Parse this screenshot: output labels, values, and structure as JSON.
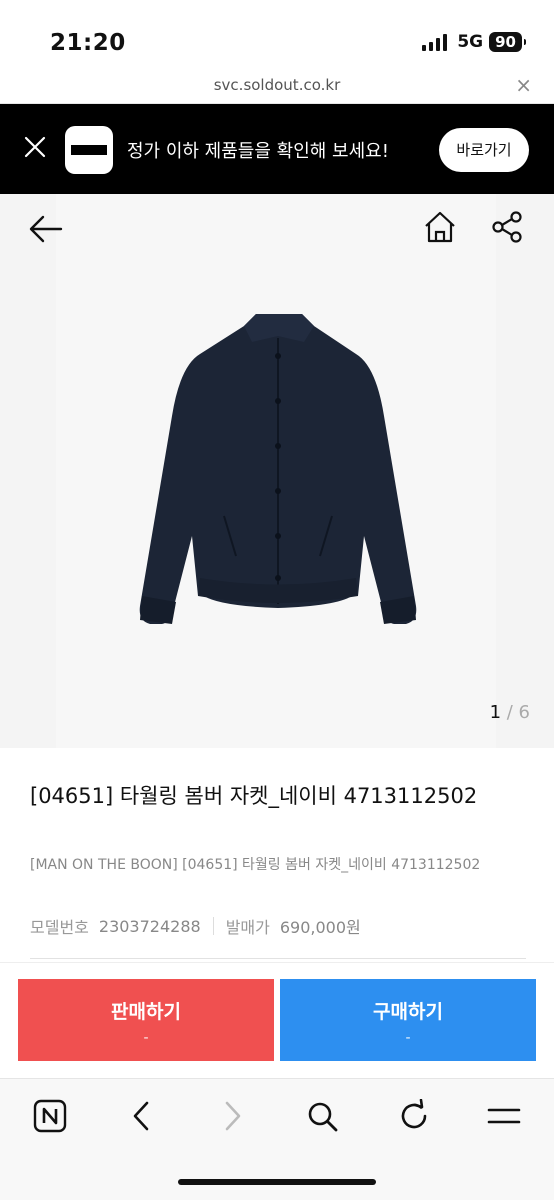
{
  "status": {
    "time": "21:20",
    "network": "5G",
    "battery": "90"
  },
  "browser": {
    "url": "svc.soldout.co.kr",
    "close_label": "×"
  },
  "promo": {
    "text": "정가 이하 제품들을 확인해 보세요!",
    "button_label": "바로가기"
  },
  "gallery": {
    "current": "1",
    "separator": " / ",
    "total": "6"
  },
  "product": {
    "title": "[04651] 타월링 봄버 자켓_네이비 4713112502",
    "subtitle": "[MAN ON THE BOON] [04651] 타월링 봄버 자켓_네이비 4713112502",
    "model_label": "모델번호",
    "model_value": "2303724288",
    "price_label": "발매가",
    "price_value": "690,000원"
  },
  "actions": {
    "sell_label": "판매하기",
    "sell_sub": "-",
    "buy_label": "구매하기",
    "buy_sub": "-"
  },
  "colors": {
    "promo_bg": "#000000",
    "sell": "#f05050",
    "buy": "#2d8ff0",
    "jacket": "#1c2536"
  },
  "icons": [
    "back-arrow-icon",
    "home-icon",
    "share-icon",
    "close-icon",
    "naver-icon",
    "chevron-left-icon",
    "chevron-right-icon",
    "search-icon",
    "refresh-icon",
    "menu-icon"
  ]
}
